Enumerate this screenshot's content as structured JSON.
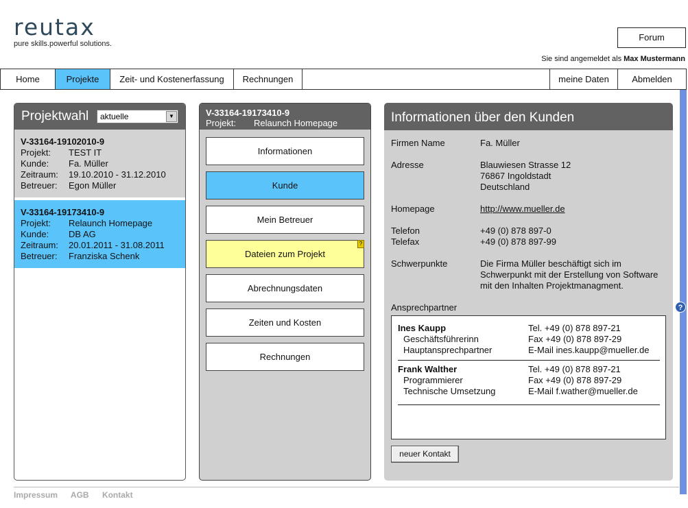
{
  "brand": {
    "name": "reutax",
    "tagline": "pure skills.powerful solutions."
  },
  "header": {
    "forum_label": "Forum",
    "login_prefix": "Sie sind angemeldet als",
    "user_name": "Max Mustermann"
  },
  "nav": {
    "items": [
      "Home",
      "Projekte",
      "Zeit- und Kostenerfassung",
      "Rechnungen"
    ],
    "active": "Projekte",
    "right_items": [
      "meine Daten",
      "Abmelden"
    ]
  },
  "project_select": {
    "title": "Projektwahl",
    "filter_value": "aktuelle",
    "labels": {
      "project": "Projekt:",
      "customer": "Kunde:",
      "period": "Zeitraum:",
      "manager": "Betreuer:"
    },
    "projects": [
      {
        "id": "V-33164-19102010-9",
        "project": "TEST IT",
        "customer": "Fa. Müller",
        "period": "19.10.2010 - 31.12.2010",
        "manager": "Egon Müller",
        "selected": false
      },
      {
        "id": "V-33164-19173410-9",
        "project": "Relaunch Homepage",
        "customer": "DB AG",
        "period": "20.01.2011 - 31.08.2011",
        "manager": "Franziska Schenk",
        "selected": true
      }
    ]
  },
  "project_menu": {
    "id": "V-33164-19173410-9",
    "project_label": "Projekt:",
    "project_name": "Relaunch Homepage",
    "items": [
      "Informationen",
      "Kunde",
      "Mein Betreuer",
      "Dateien zum Projekt",
      "Abrechnungsdaten",
      "Zeiten und Kosten",
      "Rechnungen"
    ],
    "active": "Kunde",
    "highlighted": "Dateien zum Projekt",
    "badge": "?"
  },
  "customer": {
    "title": "Informationen über den Kunden",
    "labels": {
      "company": "Firmen Name",
      "address": "Adresse",
      "homepage": "Homepage",
      "phone": "Telefon",
      "fax": "Telefax",
      "focus": "Schwerpunkte"
    },
    "company": "Fa. Müller",
    "address": [
      "Blauwiesen Strasse 12",
      "76867 Ingoldstadt",
      "Deutschland"
    ],
    "homepage": "http://www.mueller.de",
    "phone": "+49 (0) 878 897-0",
    "fax": "+49 (0) 878 897-99",
    "focus": [
      "Die Firma Müller beschäftigt sich im",
      "Schwerpunkt mit der Erstellung von Software",
      "mit den Inhalten Projektmanagment."
    ],
    "contacts_label": "Ansprechpartner",
    "contacts": [
      {
        "name": "Ines Kaupp",
        "role": "Geschäftsführerinn",
        "role2": "Hauptansprechpartner",
        "tel": "Tel. +49 (0) 878 897-21",
        "fax": "Fax +49 (0) 878 897-29",
        "email": "E-Mail ines.kaupp@mueller.de"
      },
      {
        "name": "Frank Walther",
        "role": "Programmierer",
        "role2": "Technische Umsetzung",
        "tel": "Tel. +49 (0) 878 897-21",
        "fax": "Fax +49 (0) 878 897-29",
        "email": "E-Mail f.wather@mueller.de"
      }
    ],
    "new_contact_label": "neuer Kontakt"
  },
  "help_icon": "?",
  "footer": {
    "links": [
      "Impressum",
      "AGB",
      "Kontakt"
    ]
  },
  "colors": {
    "accent": "#5ac4fa",
    "highlight": "#ffff99",
    "panel_header": "#626262",
    "panel_bg": "#d0d0d0",
    "logo": "#2e4a5c"
  }
}
